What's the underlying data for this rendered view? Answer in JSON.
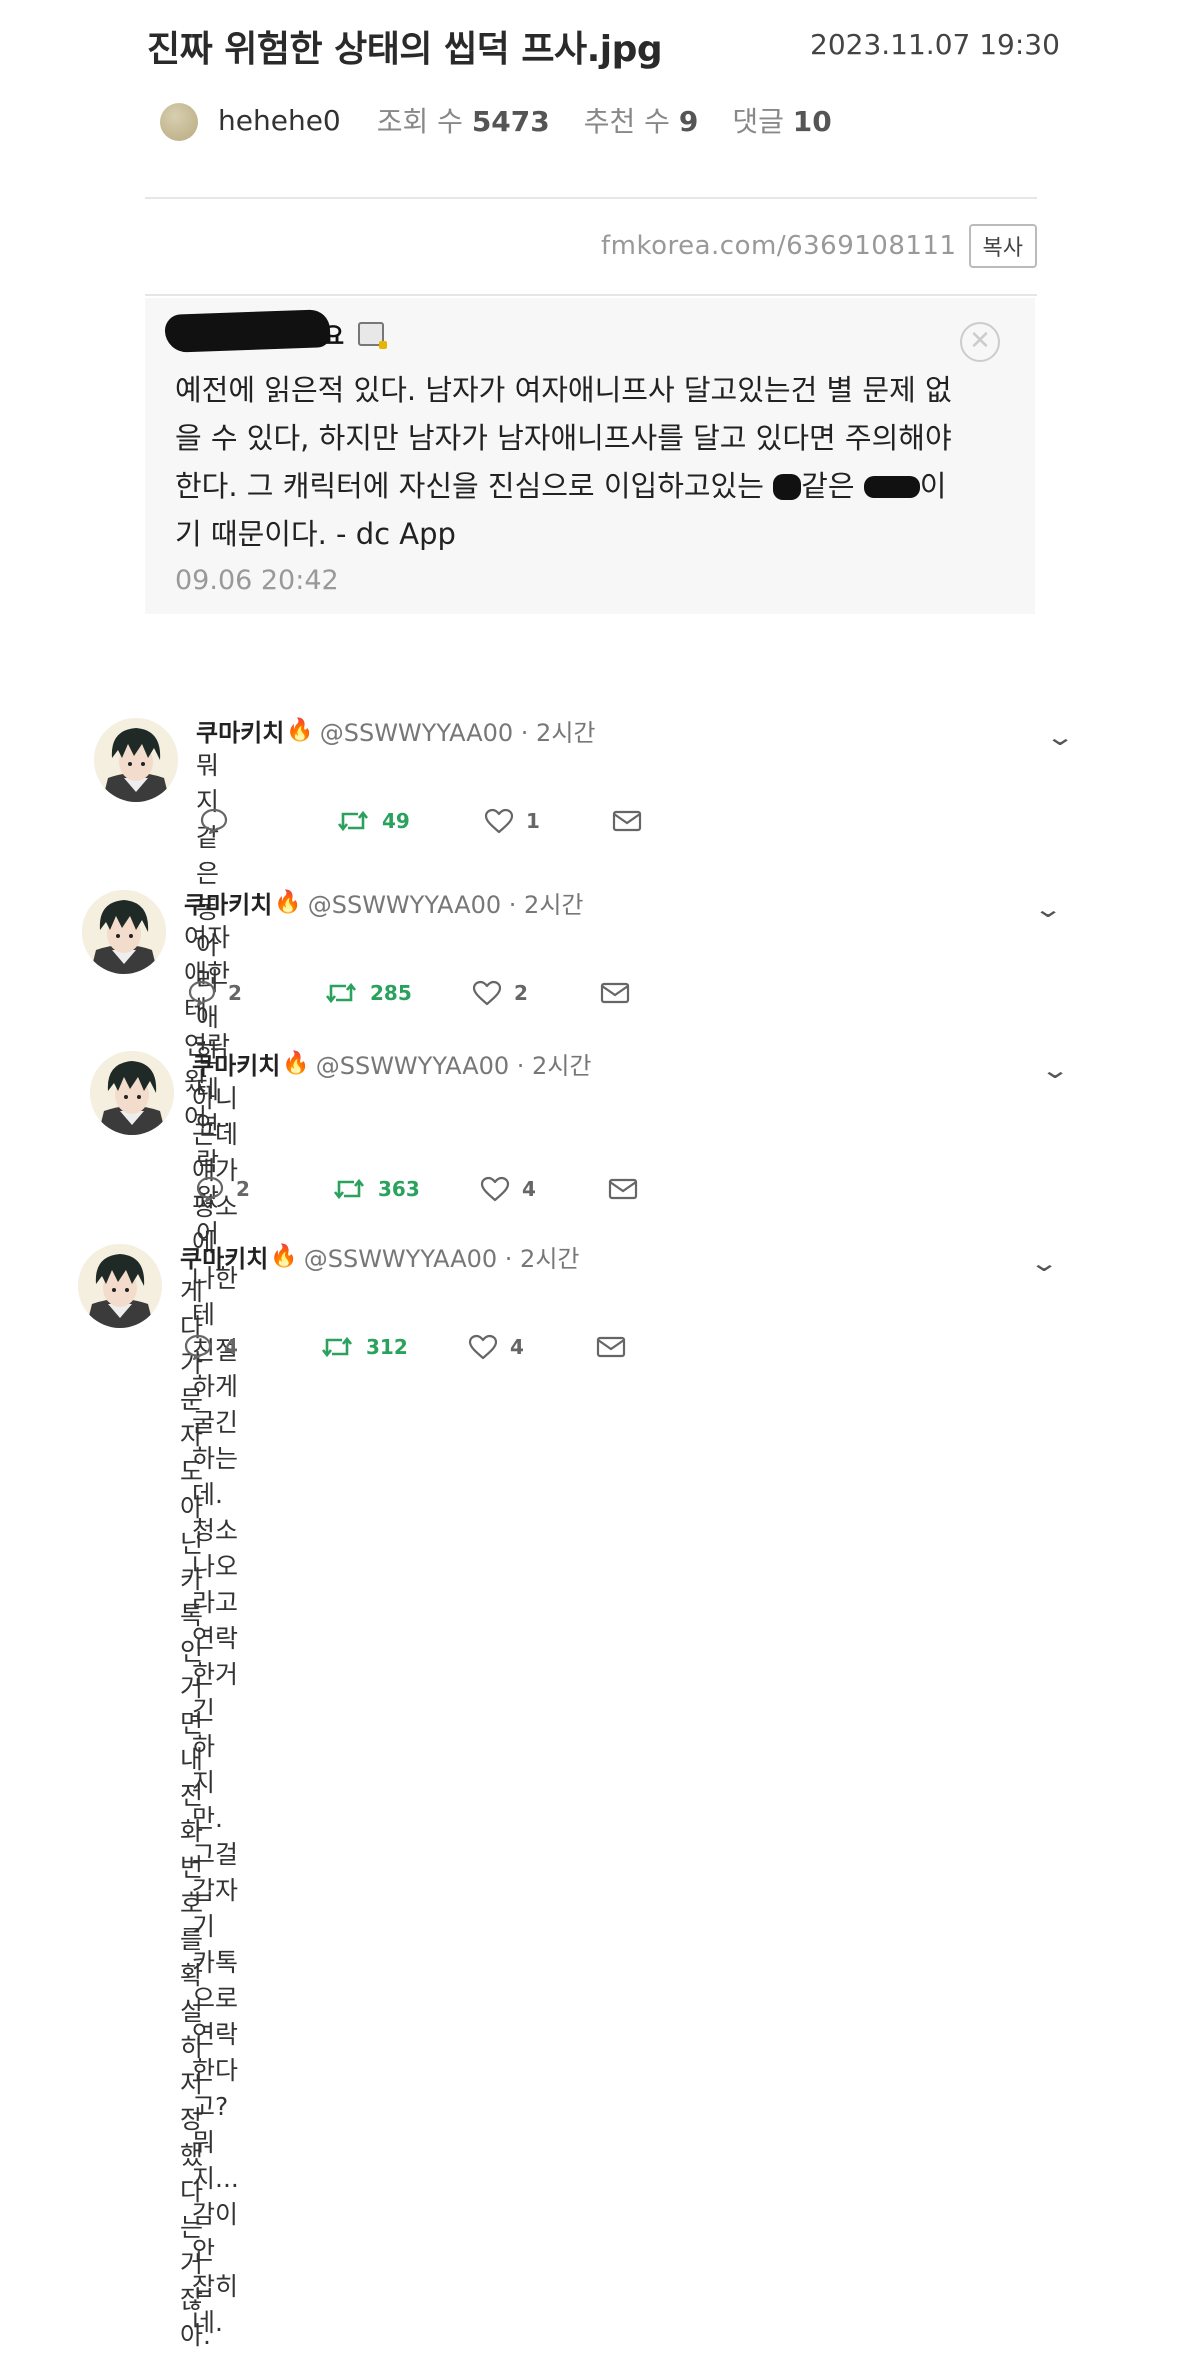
{
  "post": {
    "title": "진짜 위험한 상태의 씹덕 프사.jpg",
    "datetime": "2023.11.07 19:30",
    "author": "hehehe0",
    "views_label": "조회 수",
    "views": "5473",
    "likes_label": "추천 수",
    "likes": "9",
    "comments_label": "댓글",
    "comments": "10",
    "url": "fmkorea.com/6369108111",
    "copy_label": "복사"
  },
  "embedded_comment": {
    "name_suffix": "요",
    "line1": "예전에 읽은적 있다. 남자가 여자애니프사 달고있는건 별 문제 없",
    "line2": "을 수 있다, 하지만 남자가 남자애니프사를 달고 있다면 주의해야",
    "line3_a": "한다. 그 캐릭터에 자신을 진심으로 이입하고있는 ",
    "line3_b": "같은 ",
    "line3_c": "이",
    "line4": "기 때문이다. - dc App",
    "time": "09.06 20:42"
  },
  "tweets": [
    {
      "name": "쿠마키치",
      "handle": "@SSWWYYAA00 · 2시간",
      "lines": [
        "뭐지 같은 동아리 애한테 연락왔어"
      ],
      "reply": "",
      "retweet": "49",
      "like": "1"
    },
    {
      "name": "쿠마키치",
      "handle": "@SSWWYYAA00 · 2시간",
      "lines": [
        "여자애한테 연락왔어..."
      ],
      "reply": "2",
      "retweet": "285",
      "like": "2"
    },
    {
      "name": "쿠마키치",
      "handle": "@SSWWYYAA00 · 2시간",
      "lines": [
        "아니 근데 얘가 평소에 나한테 친절하게 굴긴하는데. 청소나오라고 연락한거긴 하",
        "지만. 그걸 갑자기 카톡으로 연락한다고? 뭐지... 감이 안 잡히네."
      ],
      "reply": "2",
      "retweet": "363",
      "like": "4"
    },
    {
      "name": "쿠마키치",
      "handle": "@SSWWYYAA00 · 2시간",
      "lines": [
        "게다가 문자도아닌 카톡인거면 내 전화번호를 확실히 저장했다는거잖아."
      ],
      "reply": "4",
      "retweet": "312",
      "like": "4"
    }
  ],
  "icons": {
    "reply": "speech-bubble-icon",
    "retweet": "retweet-icon",
    "like": "heart-icon",
    "dm": "envelope-icon",
    "more": "chevron-down-icon",
    "badge": "fire-icon"
  },
  "colors": {
    "retweet": "#2aa15d",
    "fire": "#f39a1a"
  }
}
